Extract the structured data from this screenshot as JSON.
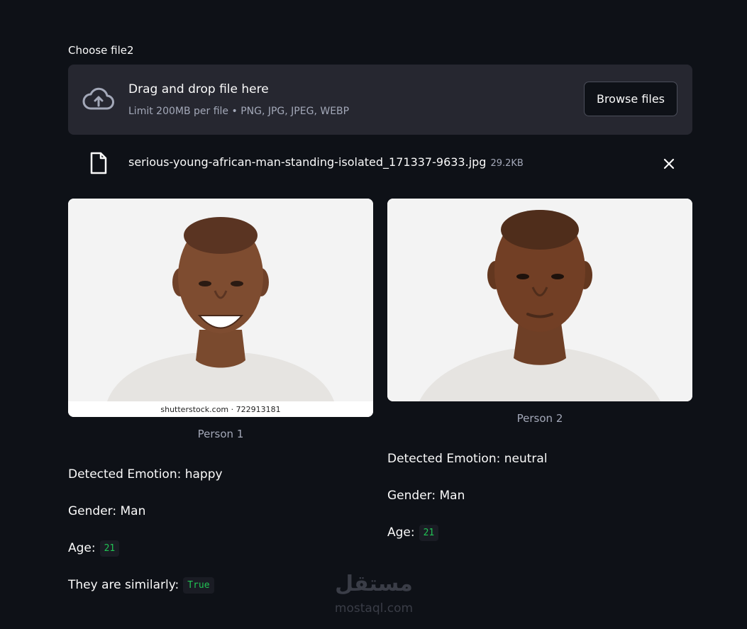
{
  "uploader": {
    "label": "Choose file2",
    "drop_title": "Drag and drop file here",
    "limit_text": "Limit 200MB per file • PNG, JPG, JPEG, WEBP",
    "browse_label": "Browse files"
  },
  "file": {
    "name": "serious-young-african-man-standing-isolated_171337-9633.jpg",
    "size": "29.2KB"
  },
  "person1": {
    "watermark": "shutterstock.com · 722913181",
    "caption": "Person 1",
    "emotion": "Detected Emotion: happy",
    "gender": "Gender: Man",
    "age_label": "Age:",
    "age_value": "21",
    "similar_label": "They are similarly:",
    "similar_value": "True"
  },
  "person2": {
    "caption": "Person 2",
    "emotion": "Detected Emotion: neutral",
    "gender": "Gender: Man",
    "age_label": "Age:",
    "age_value": "21"
  },
  "logo": {
    "arabic": "مستقل",
    "latin": "mostaql.com"
  },
  "colors": {
    "background": "#0e1117",
    "dropzone": "#262730",
    "code_text": "#21c354"
  }
}
